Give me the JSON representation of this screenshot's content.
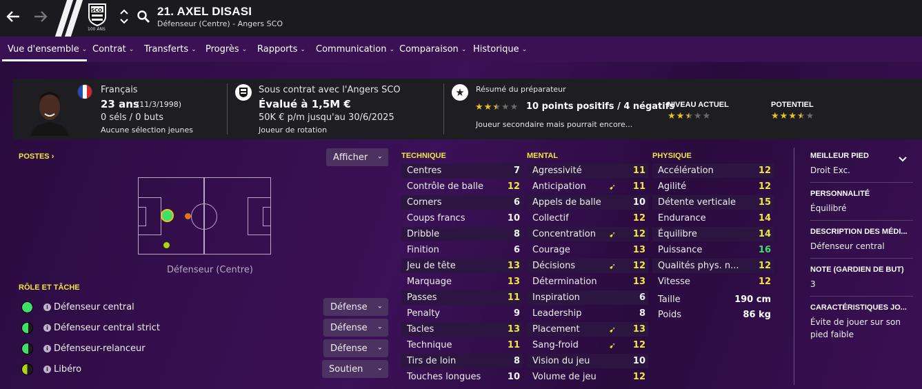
{
  "header": {
    "player_name": "21. AXEL DISASI",
    "player_subtitle": "Défenseur (Centre) - Angers SCO",
    "crest_text": "SCO",
    "crest_sub": "100 ANS"
  },
  "tabs": [
    {
      "label": "Vue d'ensemble"
    },
    {
      "label": "Contrat"
    },
    {
      "label": "Transferts"
    },
    {
      "label": "Progrès"
    },
    {
      "label": "Rapports"
    },
    {
      "label": "Communication"
    },
    {
      "label": "Comparaison"
    },
    {
      "label": "Historique"
    }
  ],
  "info": {
    "nationality": "Français",
    "age": "23 ans",
    "dob": "(11/3/1998)",
    "caps": "0 séls / 0 buts",
    "youth": "Aucune sélection jeunes",
    "contract_with": "Sous contrat avec l'Angers SCO",
    "value": "Évalué à 1,5M €",
    "wage": "50K € p/m jusqu'au 30/6/2025",
    "squad_status": "Joueur de rotation",
    "coach_report_title": "Résumé du préparateur",
    "coach_points": "10 points positifs / 4 négatifs",
    "coach_summary": "Joueur secondaire mais pourrait encore...",
    "coach_stars": 2.5,
    "current_level_label": "NIVEAU ACTUEL",
    "current_level_stars": 2.5,
    "potential_label": "POTENTIEL",
    "potential_stars": 3.5
  },
  "positions": {
    "title": "POSTES",
    "show_button": "Afficher",
    "position_label": "Défenseur (Centre)"
  },
  "roles": {
    "title": "RÔLE ET TÂCHE",
    "items": [
      {
        "name": "Défenseur central",
        "duty": "Défense",
        "suitability": 1.0
      },
      {
        "name": "Défenseur central strict",
        "duty": "Défense",
        "suitability": 0.75
      },
      {
        "name": "Défenseur-relanceur",
        "duty": "Défense",
        "suitability": 0.75
      },
      {
        "name": "Libéro",
        "duty": "Soutien",
        "suitability": 0.5
      }
    ]
  },
  "attributes": {
    "technique_title": "TECHNIQUE",
    "mental_title": "MENTAL",
    "physique_title": "PHYSIQUE",
    "technique": [
      {
        "name": "Centres",
        "value": 7,
        "arrow": false
      },
      {
        "name": "Contrôle de balle",
        "value": 12,
        "arrow": false
      },
      {
        "name": "Corners",
        "value": 6,
        "arrow": false
      },
      {
        "name": "Coups francs",
        "value": 10,
        "arrow": false
      },
      {
        "name": "Dribble",
        "value": 8,
        "arrow": false
      },
      {
        "name": "Finition",
        "value": 6,
        "arrow": false
      },
      {
        "name": "Jeu de tête",
        "value": 13,
        "arrow": false
      },
      {
        "name": "Marquage",
        "value": 13,
        "arrow": false
      },
      {
        "name": "Passes",
        "value": 11,
        "arrow": false
      },
      {
        "name": "Penalty",
        "value": 9,
        "arrow": false
      },
      {
        "name": "Tacles",
        "value": 13,
        "arrow": false
      },
      {
        "name": "Technique",
        "value": 11,
        "arrow": false
      },
      {
        "name": "Tirs de loin",
        "value": 8,
        "arrow": false
      },
      {
        "name": "Touches longues",
        "value": 10,
        "arrow": false
      }
    ],
    "mental": [
      {
        "name": "Agressivité",
        "value": 11,
        "arrow": false
      },
      {
        "name": "Anticipation",
        "value": 11,
        "arrow": true
      },
      {
        "name": "Appels de balle",
        "value": 10,
        "arrow": false
      },
      {
        "name": "Collectif",
        "value": 12,
        "arrow": false
      },
      {
        "name": "Concentration",
        "value": 12,
        "arrow": true
      },
      {
        "name": "Courage",
        "value": 13,
        "arrow": false
      },
      {
        "name": "Décisions",
        "value": 12,
        "arrow": true
      },
      {
        "name": "Détermination",
        "value": 13,
        "arrow": false
      },
      {
        "name": "Inspiration",
        "value": 6,
        "arrow": false
      },
      {
        "name": "Leadership",
        "value": 8,
        "arrow": false
      },
      {
        "name": "Placement",
        "value": 13,
        "arrow": true
      },
      {
        "name": "Sang-froid",
        "value": 12,
        "arrow": true
      },
      {
        "name": "Vision du jeu",
        "value": 10,
        "arrow": false
      },
      {
        "name": "Volume de jeu",
        "value": 12,
        "arrow": false
      }
    ],
    "physique": [
      {
        "name": "Accélération",
        "value": 12,
        "arrow": false
      },
      {
        "name": "Agilité",
        "value": 12,
        "arrow": false
      },
      {
        "name": "Détente verticale",
        "value": 15,
        "arrow": false
      },
      {
        "name": "Endurance",
        "value": 14,
        "arrow": false
      },
      {
        "name": "Équilibre",
        "value": 14,
        "arrow": false
      },
      {
        "name": "Puissance",
        "value": 16,
        "arrow": false
      },
      {
        "name": "Qualités phys. n...",
        "value": 12,
        "arrow": false
      },
      {
        "name": "Vitesse",
        "value": 12,
        "arrow": false
      }
    ],
    "height_label": "Taille",
    "height": "190 cm",
    "weight_label": "Poids",
    "weight": "86 kg"
  },
  "side": [
    {
      "title": "MEILLEUR PIED",
      "value": "Droit Exc."
    },
    {
      "title": "PERSONNALITÉ",
      "value": "Équilibré"
    },
    {
      "title": "DESCRIPTION DES MÉDI...",
      "value": "Défenseur central"
    },
    {
      "title": "NOTE (GARDIEN DE BUT)",
      "value": "3"
    },
    {
      "title": "CARACTÉRISTIQUES JO...",
      "value": "Évite de jouer sur son pied faible"
    }
  ],
  "colors": {
    "accent_yellow": "#f2e640",
    "green": "#3fe06a",
    "background": "#2a0b3e"
  }
}
